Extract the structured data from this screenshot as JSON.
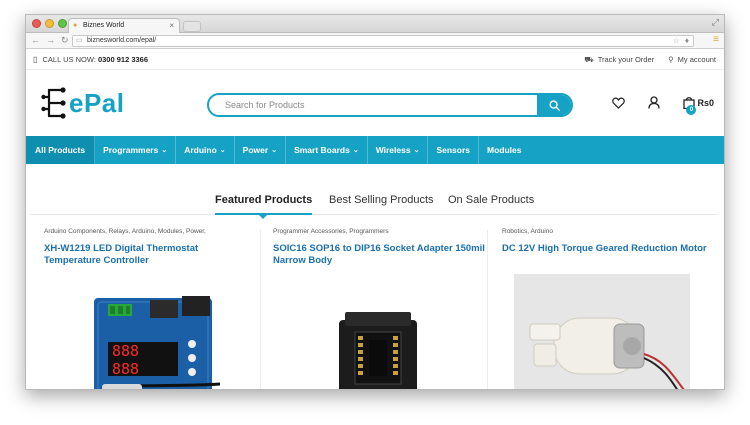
{
  "browser": {
    "tab_title": "Biznes World",
    "url": "biznesworld.com/epal/"
  },
  "topbar": {
    "call_prefix": "CALL US NOW:",
    "phone": "0300 912 3366",
    "track_order": "Track your Order",
    "my_account": "My account"
  },
  "header": {
    "logo_text": "ePal",
    "search_placeholder": "Search for Products",
    "cart_total": "Rs0",
    "cart_count": "0"
  },
  "nav": {
    "items": [
      {
        "label": "All Products",
        "dropdown": false
      },
      {
        "label": "Programmers",
        "dropdown": true
      },
      {
        "label": "Arduino",
        "dropdown": true
      },
      {
        "label": "Power",
        "dropdown": true
      },
      {
        "label": "Smart Boards",
        "dropdown": true
      },
      {
        "label": "Wireless",
        "dropdown": true
      },
      {
        "label": "Sensors",
        "dropdown": false
      },
      {
        "label": "Modules",
        "dropdown": false
      }
    ]
  },
  "product_tabs": [
    {
      "label": "Featured Products",
      "active": true
    },
    {
      "label": "Best Selling Products",
      "active": false
    },
    {
      "label": "On Sale Products",
      "active": false
    }
  ],
  "products": [
    {
      "categories": "Arduino Components, Relays, Arduino, Modules, Power,",
      "title": "XH-W1219 LED Digital Thermostat Temperature Controller"
    },
    {
      "categories": "Programmer Accessories, Programmers",
      "title": "SOIC16 SOP16 to DIP16 Socket Adapter 150mil Narrow Body"
    },
    {
      "categories": "Robotics, Arduino",
      "title": "DC 12V High Torque Geared Reduction Motor"
    }
  ],
  "colors": {
    "accent": "#16a2c4",
    "link": "#1a6fb0"
  }
}
